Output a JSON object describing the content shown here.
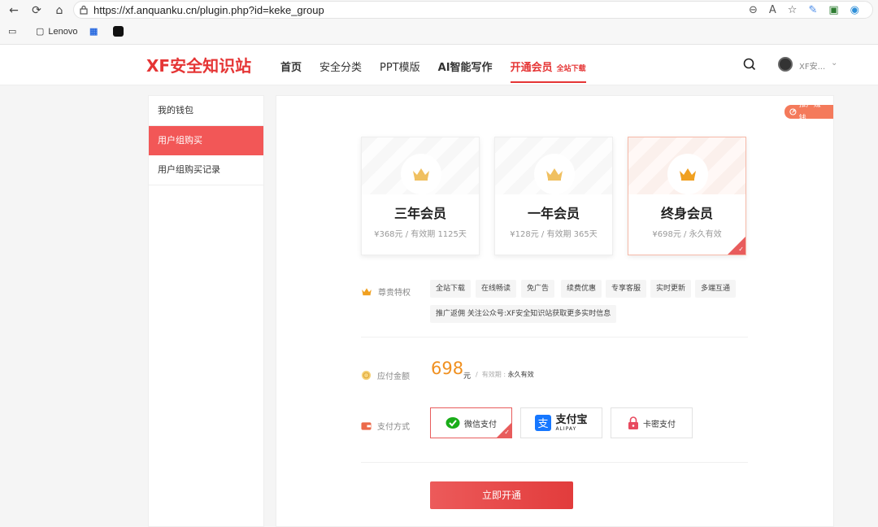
{
  "browser": {
    "url": "https://xf.anquanku.cn/plugin.php?id=keke_group",
    "bookmarks": [
      "Lenovo"
    ]
  },
  "header": {
    "logo": "XF安全知识站",
    "nav": [
      {
        "label": "首页"
      },
      {
        "label": "安全分类"
      },
      {
        "label": "PPT模版"
      },
      {
        "label": "AI智能写作"
      },
      {
        "label": "开通会员",
        "sub": "全站下载"
      }
    ],
    "user_name": "XF安..."
  },
  "sidebar": {
    "items": [
      {
        "label": "我的钱包"
      },
      {
        "label": "用户组购买"
      },
      {
        "label": "用户组购买记录"
      }
    ]
  },
  "main": {
    "promo_tag": "推广赚钱",
    "plans": [
      {
        "title": "三年会员",
        "price": "¥368元 / 有效期 1125天"
      },
      {
        "title": "一年会员",
        "price": "¥128元 / 有效期 365天"
      },
      {
        "title": "终身会员",
        "price": "¥698元 / 永久有效"
      }
    ],
    "privileges_label": "尊贵特权",
    "features": [
      "全站下载",
      "在线畅读",
      "免广告",
      "续费优惠",
      "专享客服",
      "实时更新",
      "多端互通",
      "推广返佣 关注公众号:XF安全知识站获取更多实时信息"
    ],
    "amount_label": "应付金额",
    "amount": "698",
    "amount_unit": "元",
    "amount_sep": "/",
    "validity_label": "有效期 :",
    "validity_value": "永久有效",
    "pay_label": "支付方式",
    "pay_methods": [
      {
        "label": "微信支付"
      },
      {
        "label": "支付宝",
        "sub": "ALIPAY"
      },
      {
        "label": "卡密支付"
      }
    ],
    "submit": "立即开通"
  },
  "colors": {
    "accent": "#e53535",
    "gold": "#f0a020",
    "wechat": "#1aad19",
    "alipay": "#1677ff"
  }
}
